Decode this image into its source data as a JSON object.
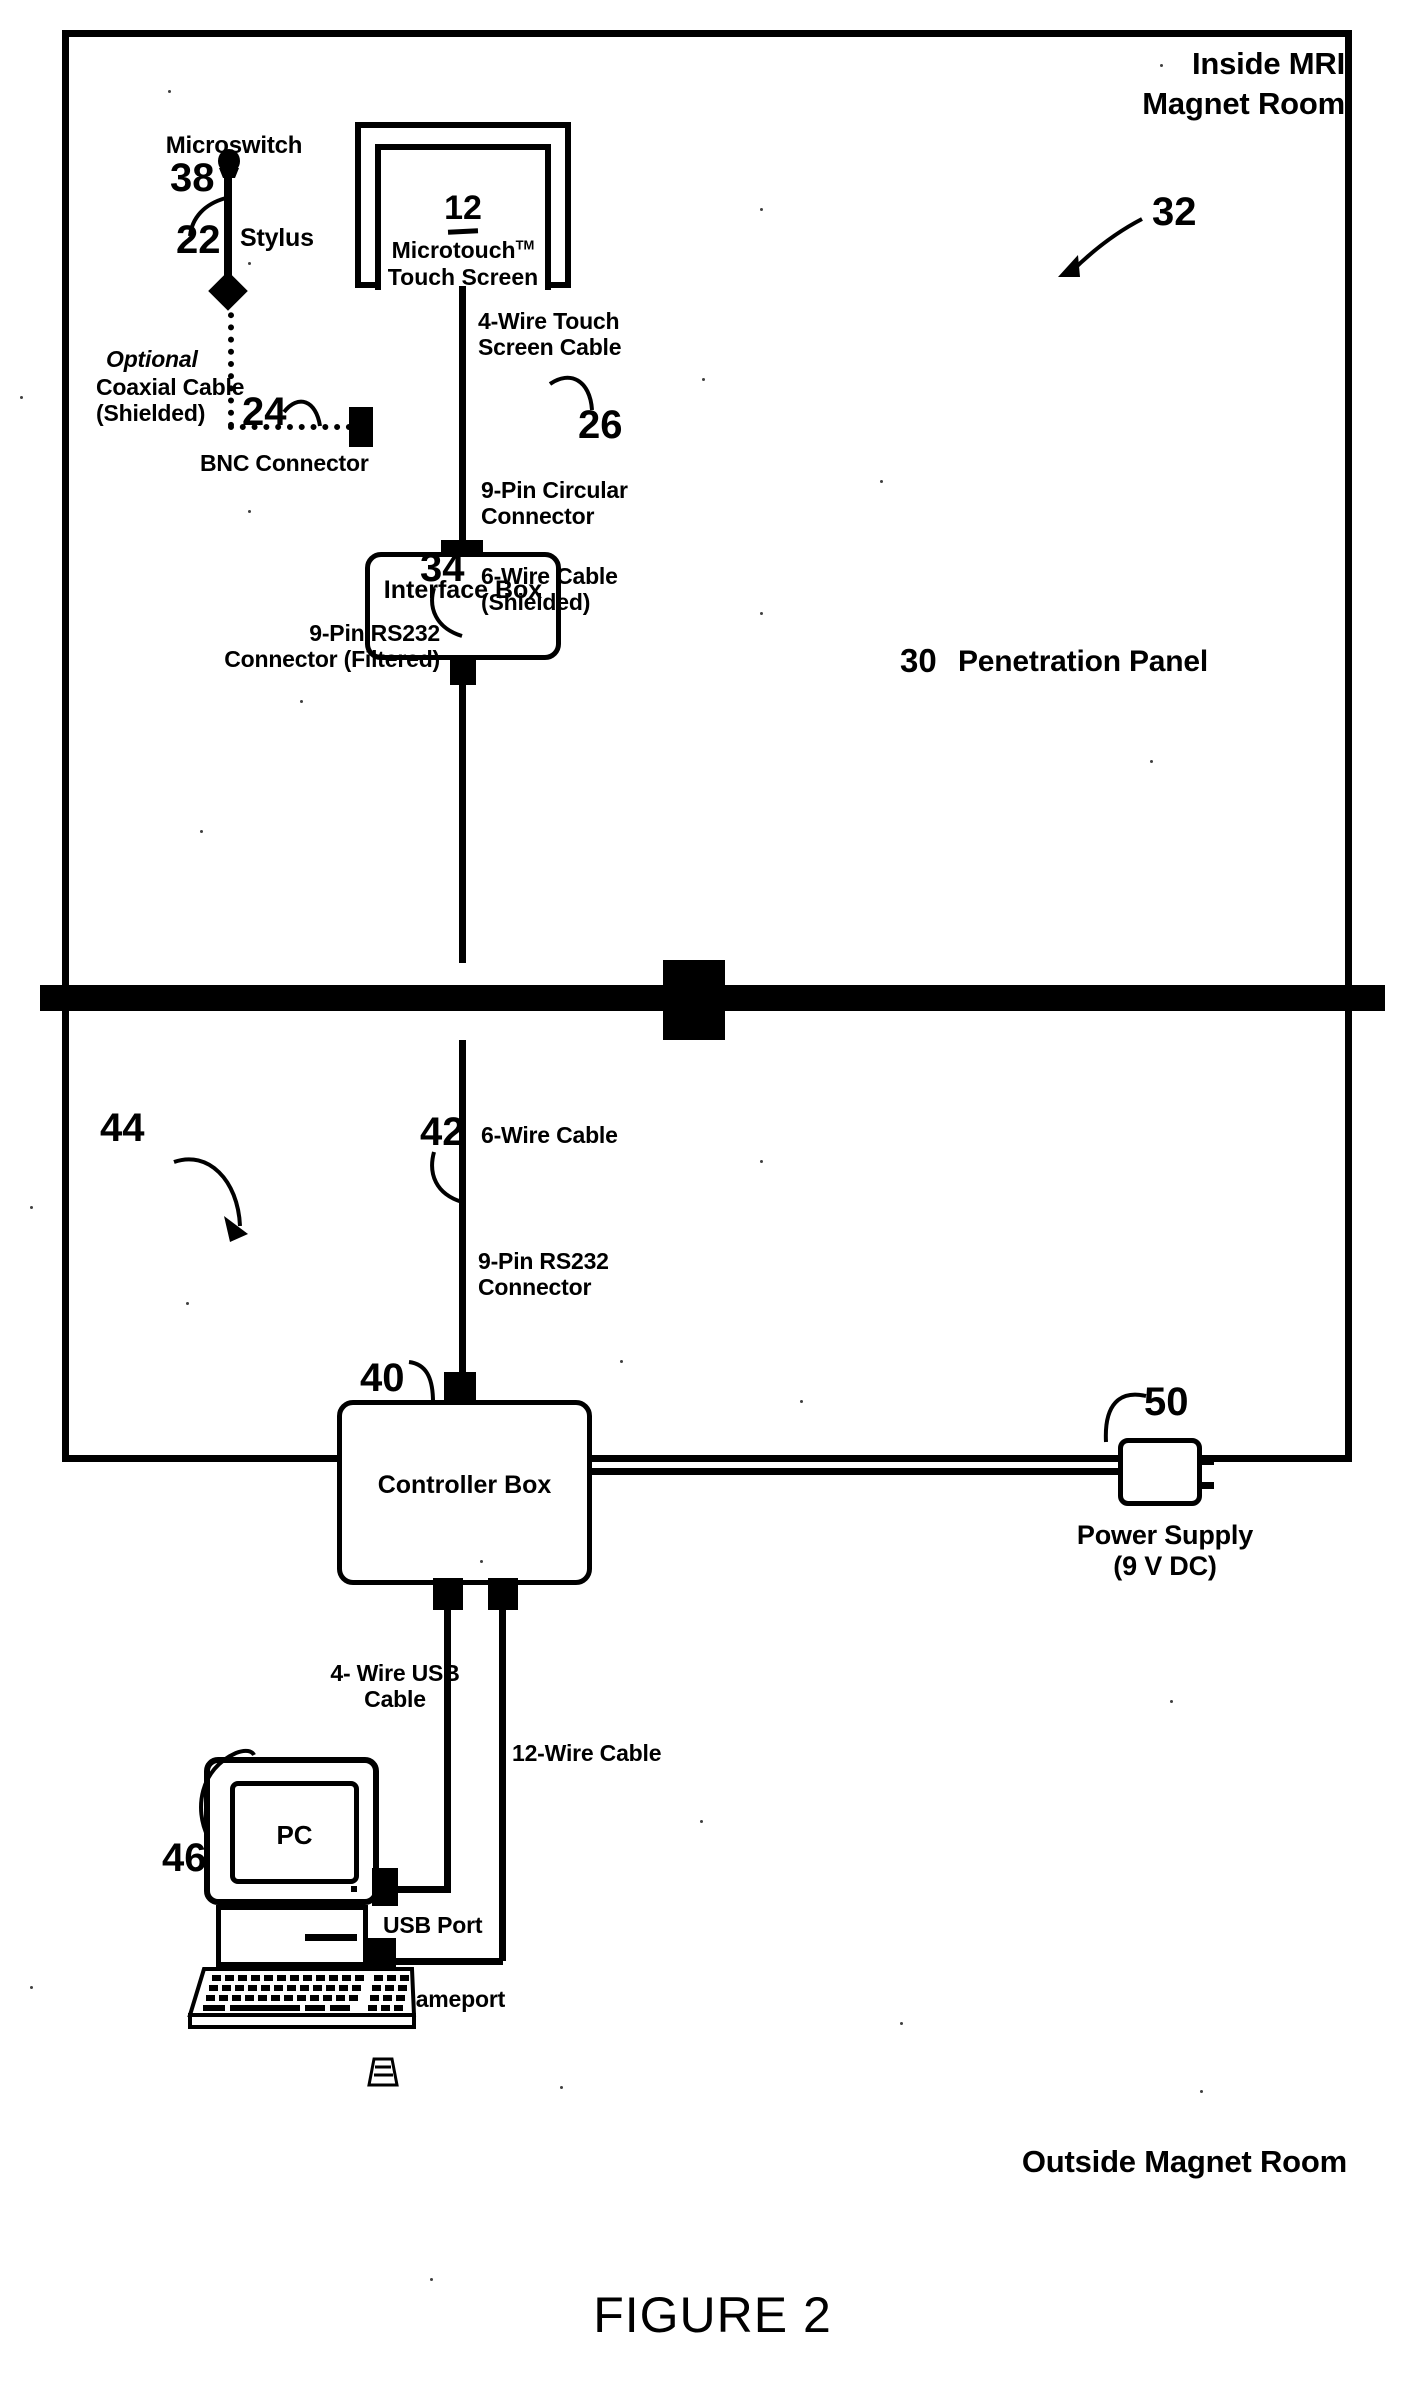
{
  "figure": {
    "caption": "FIGURE 2",
    "room_inside_label": "Inside MRI\nMagnet Room",
    "room_outside_label": "Outside Magnet Room",
    "penetration_panel_label": "Penetration Panel",
    "penetration_panel_number": "30"
  },
  "components": {
    "touch_screen": {
      "number": "12",
      "brand": "Microtouch",
      "trademark": "TM",
      "name": "Touch Screen"
    },
    "interface_box": {
      "label": "Interface\nBox",
      "number": "26"
    },
    "controller_box": {
      "label": "Controller Box",
      "number": "40"
    },
    "power_supply": {
      "label": "Power Supply\n(9 V DC)",
      "number": "50"
    },
    "pc": {
      "label": "PC",
      "number": "46"
    },
    "stylus": {
      "label": "Stylus",
      "number": "22"
    },
    "microswitch": {
      "label": "Microswitch",
      "number": "38"
    },
    "bnc_connector": {
      "label": "BNC Connector",
      "number": "24"
    },
    "system_inside": {
      "number": "32"
    },
    "system_outside": {
      "number": "44"
    }
  },
  "cables": {
    "coaxial": {
      "line1": "Optional",
      "line2": "Coaxial Cable",
      "line3": "(Shielded)"
    },
    "touch_screen_cable": "4-Wire Touch\nScreen Cable",
    "circular_connector": "9-Pin Circular\nConnector",
    "six_wire_shielded": {
      "label": "6-Wire Cable\n(Shielded)",
      "number": "34"
    },
    "rs232_filtered": "9-Pin RS232\nConnector (Filtered)",
    "six_wire": {
      "label": "6-Wire Cable",
      "number": "42"
    },
    "rs232": "9-Pin RS232\nConnector",
    "usb_cable": "4- Wire USB\nCable",
    "twelve_wire": "12-Wire Cable",
    "usb_port": "USB Port",
    "gameport": "Gameport"
  },
  "colors": {
    "ink": "#000000",
    "paper": "#ffffff"
  }
}
